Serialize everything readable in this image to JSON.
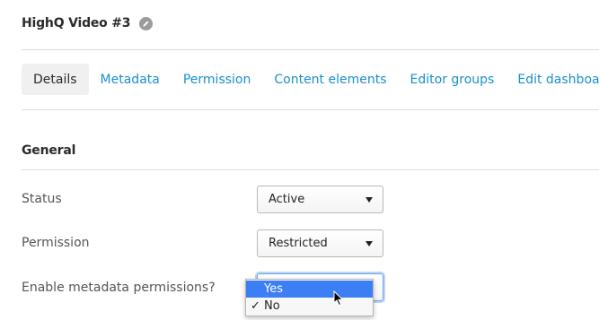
{
  "header": {
    "title": "HighQ Video #3",
    "edit_icon": "pencil-icon"
  },
  "tabs": [
    {
      "label": "Details",
      "active": true
    },
    {
      "label": "Metadata",
      "active": false
    },
    {
      "label": "Permission",
      "active": false
    },
    {
      "label": "Content elements",
      "active": false
    },
    {
      "label": "Editor groups",
      "active": false
    },
    {
      "label": "Edit dashboard",
      "active": false
    }
  ],
  "section": {
    "title": "General"
  },
  "fields": {
    "status": {
      "label": "Status",
      "value": "Active"
    },
    "permission": {
      "label": "Permission",
      "value": "Restricted"
    },
    "metadata_permissions": {
      "label": "Enable metadata permissions?",
      "value": "No"
    }
  },
  "dropdown": {
    "options": [
      {
        "label": "Yes",
        "highlighted": true,
        "checked": false
      },
      {
        "label": "No",
        "highlighted": false,
        "checked": true
      }
    ],
    "check_glyph": "✓"
  },
  "colors": {
    "link": "#1b8fcc",
    "highlight": "#3c7ef3",
    "focus_ring": "#b9d5f5"
  }
}
